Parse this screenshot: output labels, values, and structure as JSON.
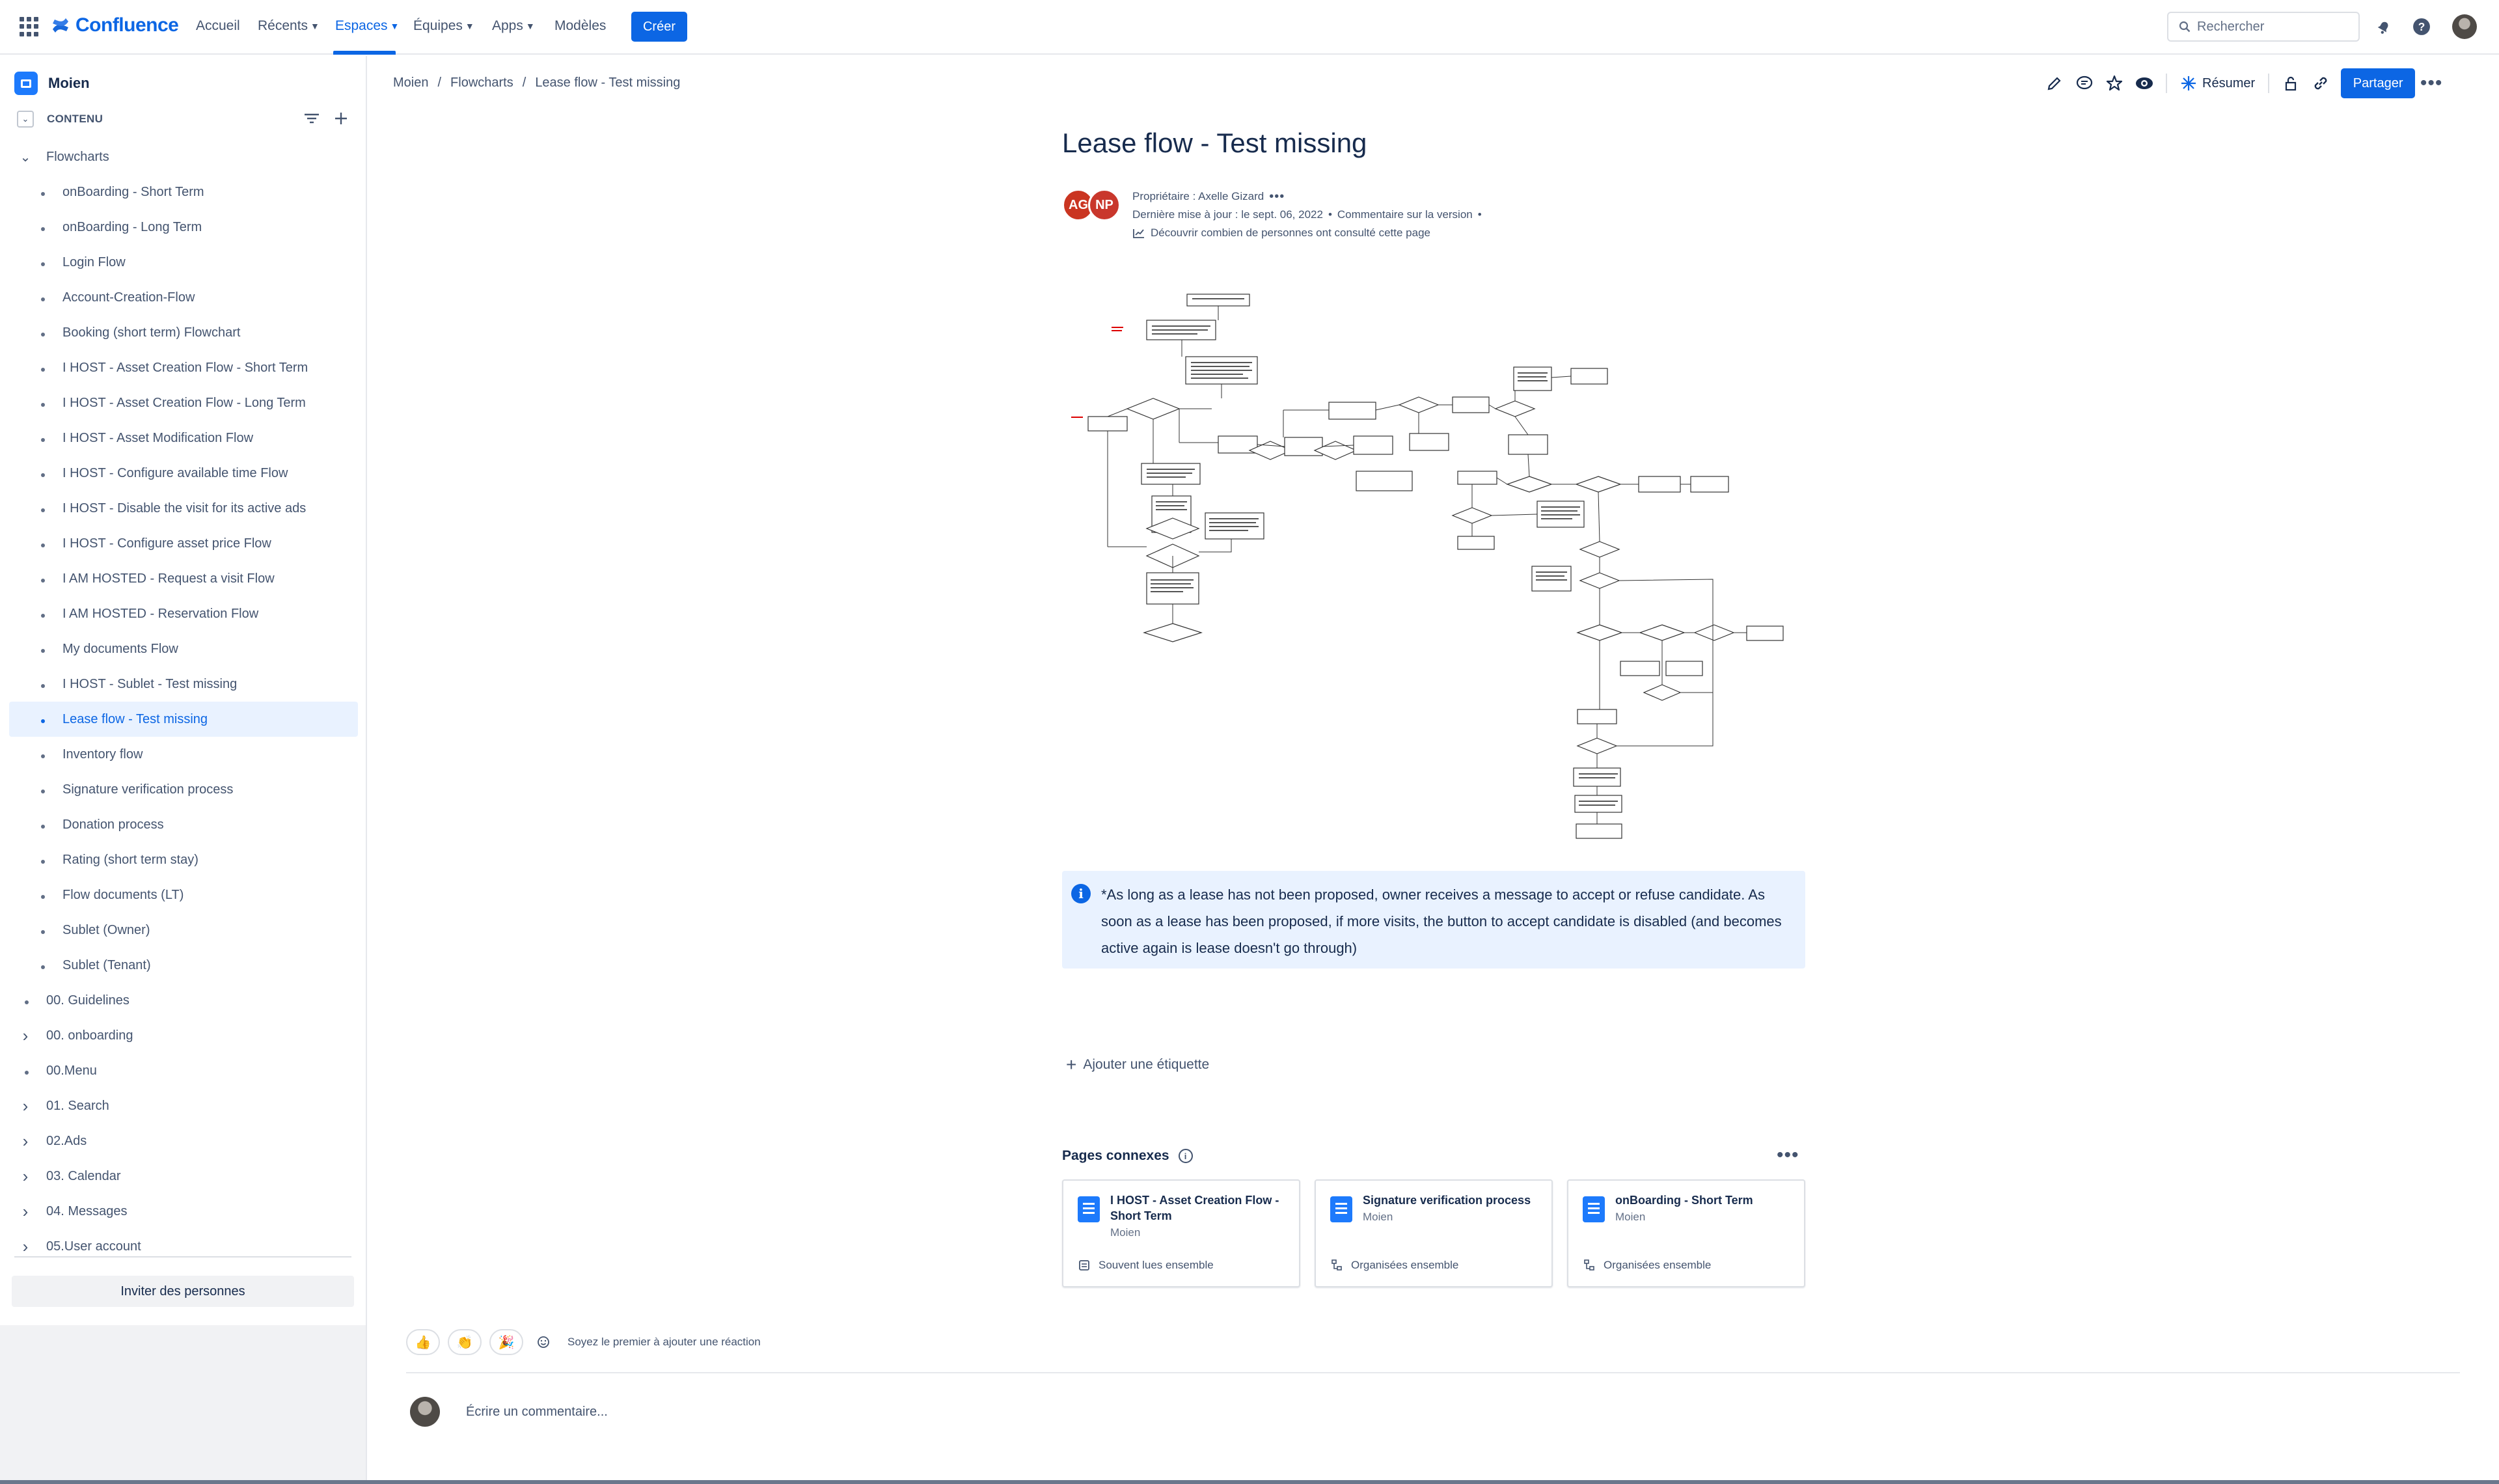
{
  "topnav": {
    "brand": "Confluence",
    "items": [
      {
        "label": "Accueil",
        "dropdown": false
      },
      {
        "label": "Récents",
        "dropdown": true
      },
      {
        "label": "Espaces",
        "dropdown": true,
        "active": true
      },
      {
        "label": "Équipes",
        "dropdown": true
      },
      {
        "label": "Apps",
        "dropdown": true
      },
      {
        "label": "Modèles",
        "dropdown": false
      }
    ],
    "create_label": "Créer",
    "search_placeholder": "Rechercher",
    "icons": [
      "app-switcher-icon",
      "notifications-icon",
      "help-icon",
      "user-avatar"
    ]
  },
  "sidebar": {
    "space_name": "Moien",
    "content_label": "CONTENU",
    "tree": [
      {
        "label": "Flowcharts",
        "level": 0,
        "expandable": true,
        "expanded": true
      },
      {
        "label": "onBoarding - Short Term",
        "level": 1
      },
      {
        "label": "onBoarding - Long Term",
        "level": 1
      },
      {
        "label": "Login Flow",
        "level": 1
      },
      {
        "label": "Account-Creation-Flow",
        "level": 1
      },
      {
        "label": "Booking (short term) Flowchart",
        "level": 1
      },
      {
        "label": "I HOST - Asset Creation Flow - Short Term",
        "level": 1
      },
      {
        "label": "I HOST - Asset Creation Flow - Long Term",
        "level": 1
      },
      {
        "label": "I HOST - Asset Modification Flow",
        "level": 1
      },
      {
        "label": "I HOST - Configure available time Flow",
        "level": 1
      },
      {
        "label": "I HOST - Disable the visit for its active ads",
        "level": 1
      },
      {
        "label": "I HOST - Configure asset price Flow",
        "level": 1
      },
      {
        "label": "I AM HOSTED - Request a visit Flow",
        "level": 1
      },
      {
        "label": "I AM HOSTED - Reservation Flow",
        "level": 1
      },
      {
        "label": "My documents Flow",
        "level": 1
      },
      {
        "label": "I HOST - Sublet - Test missing",
        "level": 1
      },
      {
        "label": "Lease flow - Test missing",
        "level": 1,
        "selected": true
      },
      {
        "label": "Inventory flow",
        "level": 1
      },
      {
        "label": "Signature verification process",
        "level": 1
      },
      {
        "label": "Donation process",
        "level": 1
      },
      {
        "label": "Rating (short term stay)",
        "level": 1
      },
      {
        "label": "Flow documents (LT)",
        "level": 1
      },
      {
        "label": "Sublet (Owner)",
        "level": 1
      },
      {
        "label": "Sublet (Tenant)",
        "level": 1
      },
      {
        "label": "00. Guidelines",
        "level": 0,
        "expandable": false
      },
      {
        "label": "00. onboarding",
        "level": 0,
        "expandable": true
      },
      {
        "label": "00.Menu",
        "level": 0,
        "expandable": false
      },
      {
        "label": "01. Search",
        "level": 0,
        "expandable": true
      },
      {
        "label": "02.Ads",
        "level": 0,
        "expandable": true
      },
      {
        "label": "03. Calendar",
        "level": 0,
        "expandable": true
      },
      {
        "label": "04. Messages",
        "level": 0,
        "expandable": true
      },
      {
        "label": "05.User account",
        "level": 0,
        "expandable": true
      }
    ],
    "invite_label": "Inviter des personnes"
  },
  "breadcrumb": [
    "Moien",
    "Flowcharts",
    "Lease flow - Test missing"
  ],
  "toolbar": {
    "summarize_label": "Résumer",
    "share_label": "Partager",
    "icons": [
      "edit-icon",
      "comment-icon",
      "star-icon",
      "watch-icon",
      "restrictions-icon",
      "link-icon",
      "more-icon"
    ]
  },
  "page": {
    "title": "Lease flow - Test missing",
    "contributors": [
      "AG",
      "NP"
    ],
    "contributor_colors": [
      "#ca3521",
      "#c9372c"
    ],
    "owner_line": "Propriétaire : Axelle Gizard",
    "updated_line": "Dernière mise à jour : le sept. 06, 2022",
    "comment_version": "Commentaire sur la version",
    "analytics_line": "Découvrir combien de personnes ont consulté cette page",
    "info_panel": "*As long as a lease has not been proposed, owner receives a message to accept or refuse candidate. As soon as a lease has been proposed, if more visits, the button to accept candidate is disabled (and becomes active again is lease doesn't go through)",
    "add_label": "Ajouter une étiquette"
  },
  "related": {
    "title": "Pages connexes",
    "cards": [
      {
        "title": "I HOST - Asset Creation Flow - Short Term",
        "space": "Moien",
        "footer": "Souvent lues ensemble",
        "footer_icon": "read-together-icon"
      },
      {
        "title": "Signature verification process",
        "space": "Moien",
        "footer": "Organisées ensemble",
        "footer_icon": "hierarchy-icon"
      },
      {
        "title": "onBoarding - Short Term",
        "space": "Moien",
        "footer": "Organisées ensemble",
        "footer_icon": "hierarchy-icon"
      }
    ]
  },
  "reactions": {
    "emojis": [
      "👍",
      "👏",
      "🎉"
    ],
    "prompt": "Soyez le premier à ajouter une réaction"
  },
  "comment": {
    "placeholder": "Écrire un commentaire..."
  },
  "colors": {
    "brand": "#0c66e4",
    "selected_bg": "#e9f2ff",
    "panel_bg": "#e9f2ff",
    "text": "#172b4d",
    "subtle": "#44546f"
  }
}
